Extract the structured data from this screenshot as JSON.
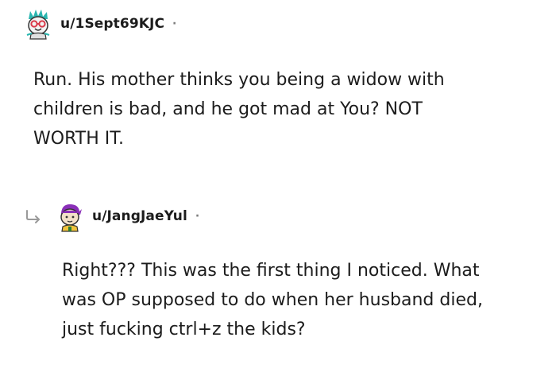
{
  "comment": {
    "username": "u/1Sept69KJC",
    "separator": "·",
    "text": "Run. His mother thinks you being a widow with\nchildren is bad, and he got mad at You? NOT\nWORTH IT."
  },
  "reply": {
    "username": "u/JangJaeYul",
    "separator": "·",
    "text": "Right??? This was the first thing I noticed. What\nwas OP supposed to do when her husband died,\njust fucking ctrl+z the kids?"
  }
}
